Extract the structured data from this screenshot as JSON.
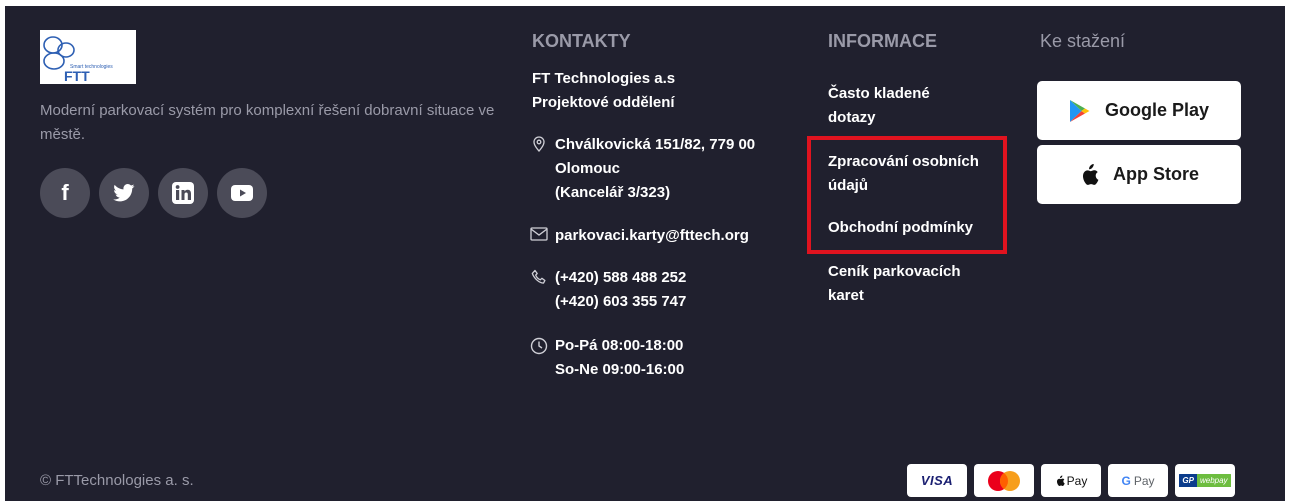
{
  "brand": {
    "logo_text": "FTT",
    "logo_subtext": "Smart technologies",
    "tagline": "Moderní parkovací systém pro komplexní řešení dobravní situace ve městě."
  },
  "socials": [
    {
      "name": "facebook-icon",
      "glyph": "f"
    },
    {
      "name": "twitter-icon"
    },
    {
      "name": "linkedin-icon",
      "glyph": "in"
    },
    {
      "name": "youtube-icon"
    }
  ],
  "contacts": {
    "title": "KONTAKTY",
    "company_line1": "FT Technologies a.s",
    "company_line2": "Projektové oddělení",
    "address_line1": "Chválkovická 151/82, 779 00",
    "address_line2": "Olomouc",
    "address_line3": "(Kancelář 3/323)",
    "email": "parkovaci.karty@fttech.org",
    "phone1": "(+420) 588 488 252",
    "phone2": "(+420) 603 355 747",
    "hours1": "Po-Pá 08:00-18:00",
    "hours2": "So-Ne 09:00-16:00"
  },
  "info": {
    "title": "INFORMACE",
    "faq_line1": "Často kladené",
    "faq_line2": "dotazy",
    "privacy_line1": "Zpracování osobních",
    "privacy_line2": "údajů",
    "terms": "Obchodní podmínky",
    "pricing_line1": "Ceník parkovacích",
    "pricing_line2": "karet"
  },
  "downloads": {
    "title": "Ke stažení",
    "google_play": "Google Play",
    "app_store": "App Store"
  },
  "footer": {
    "copyright": "© FTTechnologies a. s."
  },
  "payments": {
    "visa": "VISA",
    "apple_pay": "Pay",
    "google_pay": "Pay",
    "gp_webpay_short": "GP",
    "gp_webpay": "webpay"
  },
  "colors": {
    "background": "#20202e",
    "muted_text": "#9a9aa8",
    "social_bg": "#4b4b58",
    "highlight": "#e0131f"
  }
}
